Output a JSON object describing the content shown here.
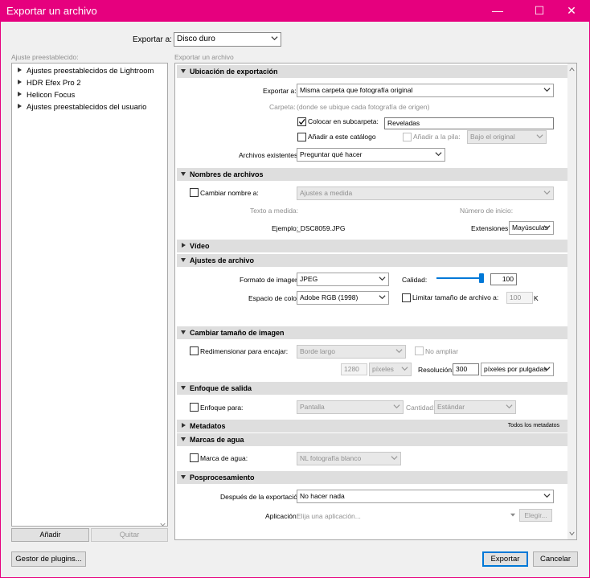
{
  "window": {
    "title": "Exportar un archivo",
    "minimize_glyph": "—",
    "maximize_glyph": "☐",
    "close_glyph": "✕"
  },
  "top": {
    "export_to_label": "Exportar a:",
    "export_to_value": "Disco duro"
  },
  "left_panel": {
    "heading": "Ajuste preestablecido:",
    "items": [
      {
        "label": "Ajustes preestablecidos de Lightroom"
      },
      {
        "label": "HDR Efex Pro 2"
      },
      {
        "label": "Helicon Focus"
      },
      {
        "label": "Ajustes preestablecidos del usuario"
      }
    ],
    "add_button": "Añadir",
    "remove_button": "Quitar"
  },
  "right_panel": {
    "heading": "Exportar un archivo"
  },
  "location": {
    "header": "Ubicación de exportación",
    "export_to_label": "Exportar a:",
    "export_to_value": "Misma carpeta que fotografía original",
    "folder_label": "Carpeta:",
    "folder_value": "(donde se ubique cada fotografía de origen)",
    "subfolder_label": "Colocar en subcarpeta:",
    "subfolder_checked": true,
    "subfolder_value": "Reveladas",
    "add_catalog_label": "Añadir a este catálogo",
    "add_stack_label": "Añadir a la pila:",
    "stack_value": "Bajo el original",
    "existing_label": "Archivos existentes:",
    "existing_value": "Preguntar qué hacer"
  },
  "naming": {
    "header": "Nombres de archivos",
    "rename_label": "Cambiar nombre a:",
    "rename_value": "Ajustes a medida",
    "custom_text_label": "Texto a medida:",
    "start_number_label": "Número de inicio:",
    "example_label": "Ejemplo:",
    "example_value": "_DSC8059.JPG",
    "extensions_label": "Extensiones:",
    "extensions_value": "Mayúsculas"
  },
  "video": {
    "header": "Vídeo"
  },
  "file_settings": {
    "header": "Ajustes de archivo",
    "format_label": "Formato de imagen:",
    "format_value": "JPEG",
    "quality_label": "Calidad:",
    "quality_value": "100",
    "quality_fraction": 1.0,
    "colorspace_label": "Espacio de color:",
    "colorspace_value": "Adobe RGB (1998)",
    "limit_label": "Limitar tamaño de archivo a:",
    "limit_value": "100",
    "limit_unit": "K"
  },
  "resize": {
    "header": "Cambiar tamaño de imagen",
    "resize_label": "Redimensionar para encajar:",
    "resize_value": "Borde largo",
    "no_enlarge_label": "No ampliar",
    "size_value": "1280",
    "size_unit": "píxeles",
    "resolution_label": "Resolución:",
    "resolution_value": "300",
    "resolution_unit": "píxeles por pulgadas"
  },
  "sharpen": {
    "header": "Enfoque de salida",
    "sharpen_label": "Enfoque para:",
    "sharpen_value": "Pantalla",
    "amount_label": "Cantidad:",
    "amount_value": "Estándar"
  },
  "metadata": {
    "header": "Metadatos",
    "summary": "Todos los metadatos"
  },
  "watermark": {
    "header": "Marcas de agua",
    "watermark_label": "Marca de agua:",
    "watermark_value": "NL fotografía blanco"
  },
  "postprocessing": {
    "header": "Posprocesamiento",
    "after_label": "Después de la exportación:",
    "after_value": "No hacer nada",
    "app_label": "Aplicación:",
    "app_placeholder": "Elija una aplicación...",
    "choose_button": "Elegir..."
  },
  "footer": {
    "plugins_button": "Gestor de plugins...",
    "export_button": "Exportar",
    "cancel_button": "Cancelar"
  }
}
